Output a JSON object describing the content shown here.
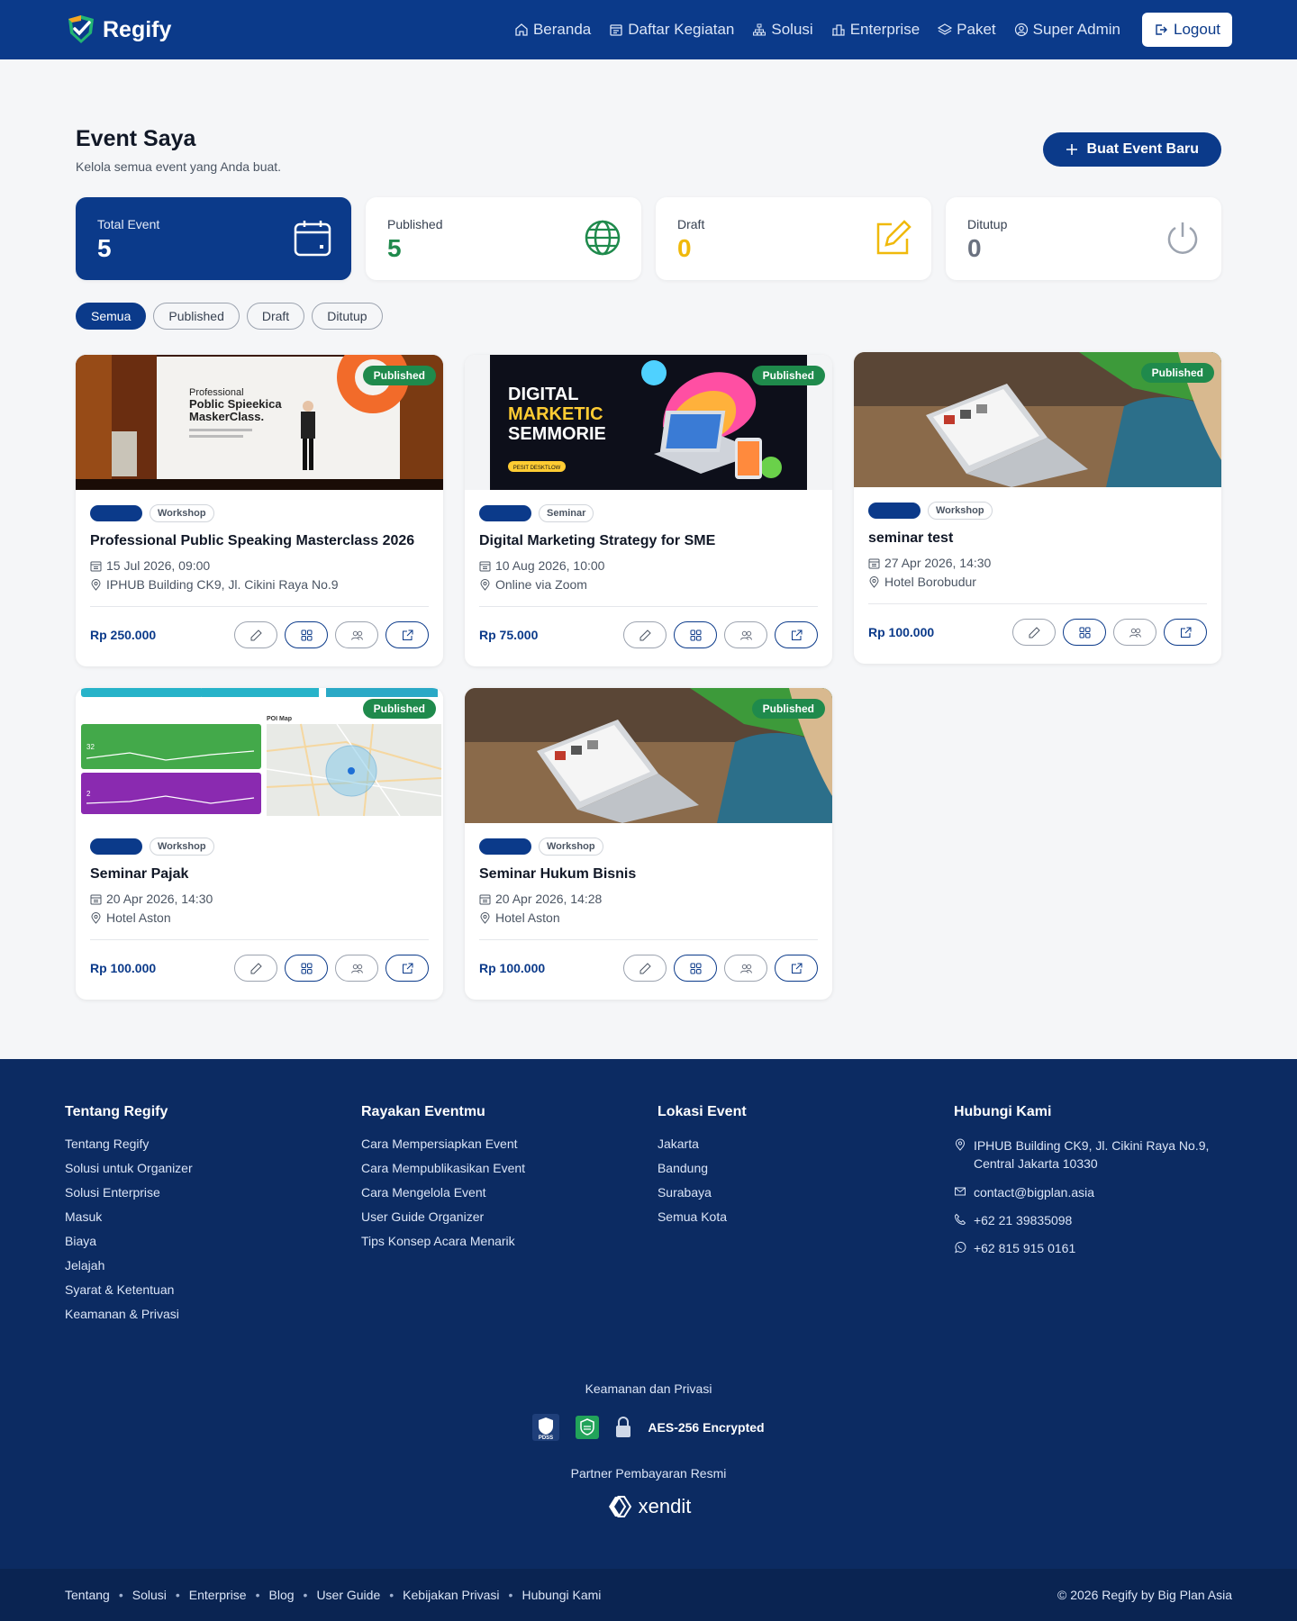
{
  "nav": {
    "brand": "Regify",
    "links": [
      {
        "label": "Beranda",
        "icon": "home-icon"
      },
      {
        "label": "Daftar Kegiatan",
        "icon": "calendar-list-icon"
      },
      {
        "label": "Solusi",
        "icon": "sitemap-icon"
      },
      {
        "label": "Enterprise",
        "icon": "building-icon"
      },
      {
        "label": "Paket",
        "icon": "layers-icon"
      },
      {
        "label": "Super Admin",
        "icon": "user-circle-icon"
      }
    ],
    "logout": "Logout"
  },
  "header": {
    "title": "Event Saya",
    "subtitle": "Kelola semua event yang Anda buat.",
    "new_button": "Buat Event Baru"
  },
  "stats": [
    {
      "label": "Total Event",
      "value": "5",
      "icon": "calendar-icon",
      "color": "#ffffff"
    },
    {
      "label": "Published",
      "value": "5",
      "icon": "globe-icon",
      "color": "#1f8a4c"
    },
    {
      "label": "Draft",
      "value": "0",
      "icon": "pencil-square-icon",
      "color": "#f0b90b"
    },
    {
      "label": "Ditutup",
      "value": "0",
      "icon": "power-icon",
      "color": "#6b7280"
    }
  ],
  "filters": [
    "Semua",
    "Published",
    "Draft",
    "Ditutup"
  ],
  "events": [
    {
      "status": "Published",
      "category": "Workshop",
      "title": "Professional Public Speaking Masterclass 2026",
      "date": "15 Jul 2026, 09:00",
      "location": "IPHUB Building CK9, Jl. Cikini Raya No.9",
      "price": "Rp 250.000",
      "image_text": {
        "line1": "Professional",
        "line2": "Poblic Spieekica",
        "line3": "MaskerClass."
      }
    },
    {
      "status": "Published",
      "category": "Seminar",
      "title": "Digital Marketing Strategy for SME",
      "date": "10 Aug 2026, 10:00",
      "location": "Online via Zoom",
      "price": "Rp 75.000",
      "image_text": {
        "line1": "DIGITAL",
        "line2": "MARKETIC",
        "line3": "SEMMORIE",
        "button": "PESIT DESKTLOW"
      }
    },
    {
      "status": "Published",
      "category": "Workshop",
      "title": "seminar test",
      "date": "27 Apr 2026, 14:30",
      "location": "Hotel Borobudur",
      "price": "Rp 100.000"
    },
    {
      "status": "Published",
      "category": "Workshop",
      "title": "Seminar Pajak",
      "date": "20 Apr 2026, 14:30",
      "location": "Hotel Aston",
      "price": "Rp 100.000",
      "image_text": {
        "map": "POI Map",
        "stat1": "32",
        "stat2": "2"
      }
    },
    {
      "status": "Published",
      "category": "Workshop",
      "title": "Seminar Hukum Bisnis",
      "date": "20 Apr 2026, 14:28",
      "location": "Hotel Aston",
      "price": "Rp 100.000"
    }
  ],
  "footer": {
    "cols": [
      {
        "title": "Tentang Regify",
        "links": [
          "Tentang Regify",
          "Solusi untuk Organizer",
          "Solusi Enterprise",
          "Masuk",
          "Biaya",
          "Jelajah",
          "Syarat & Ketentuan",
          "Keamanan & Privasi"
        ]
      },
      {
        "title": "Rayakan Eventmu",
        "links": [
          "Cara Mempersiapkan Event",
          "Cara Mempublikasikan Event",
          "Cara Mengelola Event",
          "User Guide Organizer",
          "Tips Konsep Acara Menarik"
        ]
      },
      {
        "title": "Lokasi Event",
        "links": [
          "Jakarta",
          "Bandung",
          "Surabaya",
          "Semua Kota"
        ]
      }
    ],
    "contact": {
      "title": "Hubungi Kami",
      "address": "IPHUB Building CK9, Jl. Cikini Raya No.9, Central Jakarta 10330",
      "email": "contact@bigplan.asia",
      "phone": "+62 21 39835098",
      "whatsapp": "+62 815 915 0161"
    },
    "security_title": "Keamanan dan Privasi",
    "pdss_label": "PDSS",
    "aes": "AES-256 Encrypted",
    "partner_title": "Partner Pembayaran Resmi",
    "partner_name": "xendit",
    "bottom_links": [
      "Tentang",
      "Solusi",
      "Enterprise",
      "Blog",
      "User Guide",
      "Kebijakan Privasi",
      "Hubungi Kami"
    ],
    "copyright": "© 2026 Regify by Big Plan Asia"
  },
  "colors": {
    "primary": "#0b3a8a",
    "published": "#1f8a4c",
    "footer": "#0c2b62"
  }
}
